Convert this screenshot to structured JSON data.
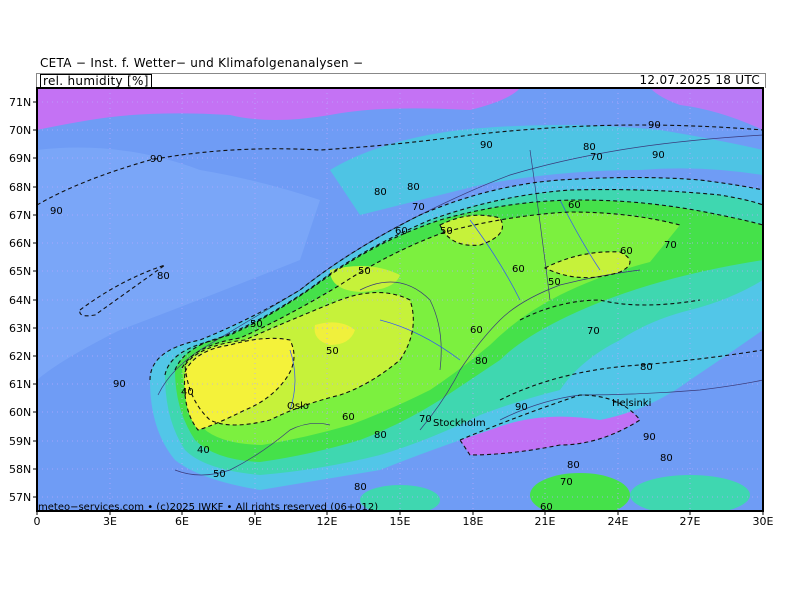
{
  "header": {
    "organization": "CETA − Inst. f. Wetter− und Klimafolgenanalysen −",
    "variable": "rel. humidity [%]",
    "valid_time": "12.07.2025 18 UTC"
  },
  "footer": {
    "credit": "meteo−services.com • (c)2025 IWKF • All rights reserved (06+012)"
  },
  "map": {
    "cities": [
      "Oslo",
      "Stockholm",
      "Helsinki"
    ],
    "lat_labels": [
      "71N",
      "70N",
      "69N",
      "68N",
      "67N",
      "66N",
      "65N",
      "64N",
      "63N",
      "62N",
      "61N",
      "60N",
      "59N",
      "58N",
      "57N"
    ],
    "lon_labels": [
      "0",
      "3E",
      "6E",
      "9E",
      "12E",
      "15E",
      "18E",
      "21E",
      "24E",
      "27E",
      "30E"
    ],
    "contour_labels": [
      "90",
      "90",
      "90",
      "90",
      "90",
      "80",
      "70",
      "60",
      "50",
      "80",
      "70",
      "60",
      "50",
      "80",
      "50",
      "60",
      "70",
      "90",
      "80",
      "60",
      "50",
      "50",
      "40",
      "40",
      "50",
      "60",
      "70",
      "80",
      "90",
      "80",
      "60",
      "70",
      "80",
      "90",
      "80",
      "70",
      "60",
      "80",
      "80"
    ],
    "colors": {
      "ocean_blue": "#6b98f4",
      "deep_blue": "#7aa4f8",
      "purple": "#c071f5",
      "cyan": "#55c9e0",
      "teal": "#3fd7b0",
      "green": "#43e84b",
      "light_green": "#7df03c",
      "yellow_green": "#c6f23a",
      "yellow": "#f4f23a"
    }
  }
}
